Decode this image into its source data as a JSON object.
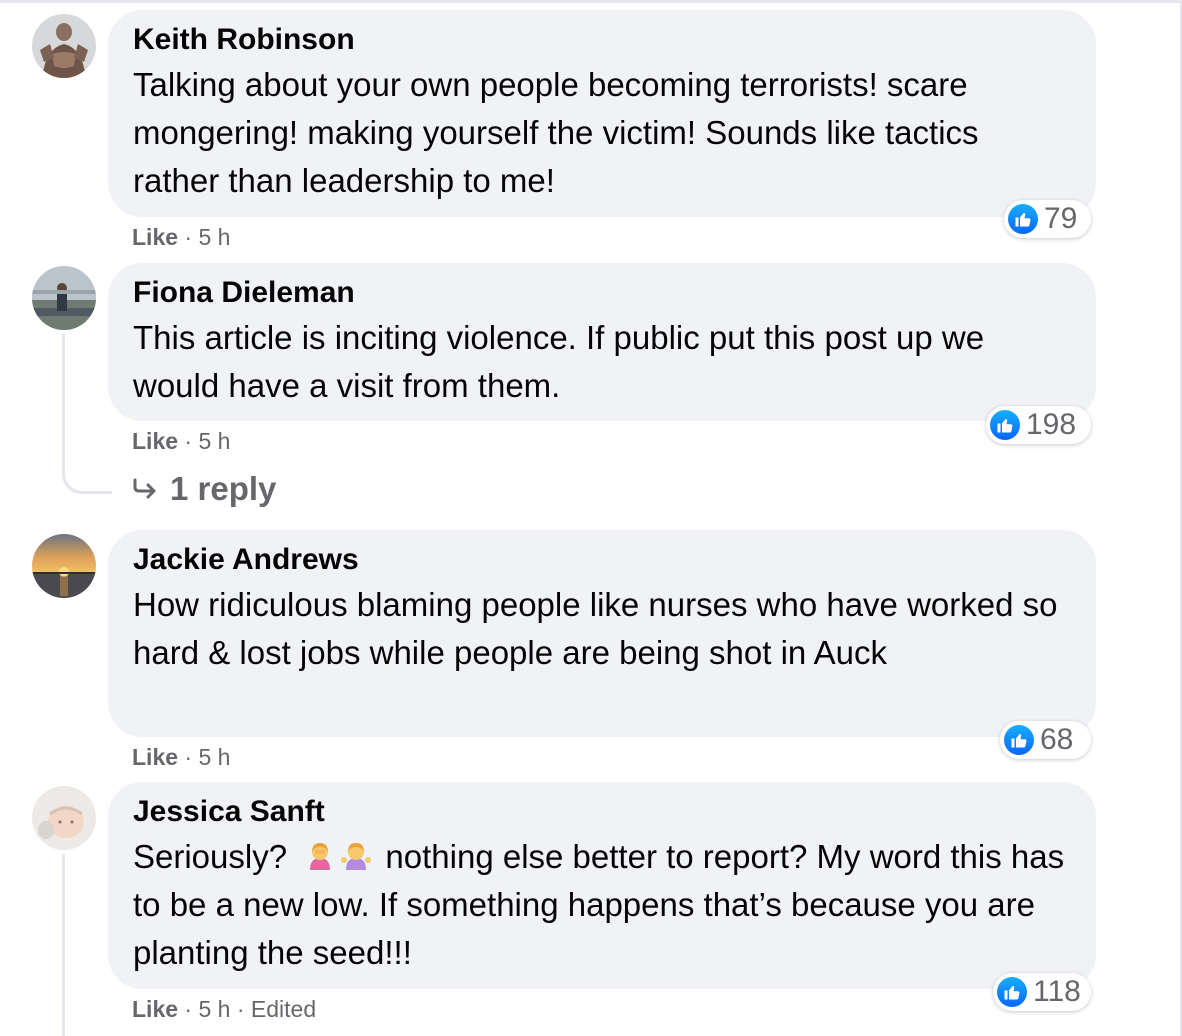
{
  "comments": [
    {
      "author": "Keith Robinson",
      "text": "Talking about your own people becoming terrorists! scare mongering! making yourself the victim! Sounds like tactics rather than leadership to me!",
      "reaction_count": "79",
      "like_label": "Like",
      "separator": "·",
      "time": "5 h",
      "avatar_icon": "muscle-figure-avatar"
    },
    {
      "author": "Fiona Dieleman",
      "text": "This article is inciting violence. If public put this post up we would have a visit from them.",
      "reaction_count": "198",
      "like_label": "Like",
      "separator": "·",
      "time": "5 h",
      "avatar_icon": "outdoor-person-avatar",
      "replies_label": "1 reply"
    },
    {
      "author": "Jackie Andrews",
      "text": "How ridiculous blaming people like nurses who have worked so hard & lost jobs while people are being shot in Auck",
      "reaction_count": "68",
      "like_label": "Like",
      "separator": "·",
      "time": "5 h",
      "avatar_icon": "sunset-avatar"
    },
    {
      "author": "Jessica Sanft",
      "text_prefix": "Seriously?",
      "text_emojis": [
        "woman-facepalming-emoji",
        "woman-shrugging-emoji"
      ],
      "text": "nothing else better to report? My word this has to be a new low. If something happens that’s because you are planting the seed!!!",
      "reaction_count": "118",
      "like_label": "Like",
      "separator": "·",
      "time": "5 h",
      "edited_label": "Edited",
      "avatar_icon": "baby-avatar"
    }
  ],
  "colors": {
    "bubble_bg": "#f0f2f5",
    "secondary_text": "#65676b",
    "like_blue": "#0866ff"
  }
}
